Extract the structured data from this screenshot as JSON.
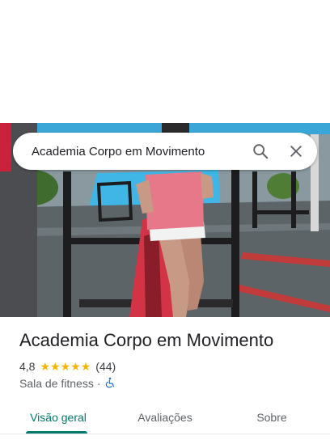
{
  "search": {
    "value": "Academia Corpo em Movimento"
  },
  "icons": {
    "search": "search-icon",
    "close": "close-icon",
    "star": "star-icon",
    "accessibility": "wheelchair-accessible-icon"
  },
  "place": {
    "name": "Academia Corpo em Movimento",
    "rating": "4,8",
    "stars": 5,
    "review_count": "(44)",
    "category": "Sala de fitness",
    "separator": "·"
  },
  "tabs": [
    {
      "label": "Visão geral",
      "active": true
    },
    {
      "label": "Avaliações",
      "active": false
    },
    {
      "label": "Sobre",
      "active": false
    }
  ],
  "colors": {
    "accent": "#00796b",
    "star": "#f6b400",
    "accessibility_icon": "#1a73e8",
    "text_primary": "#202124",
    "text_secondary": "#5f6368"
  }
}
